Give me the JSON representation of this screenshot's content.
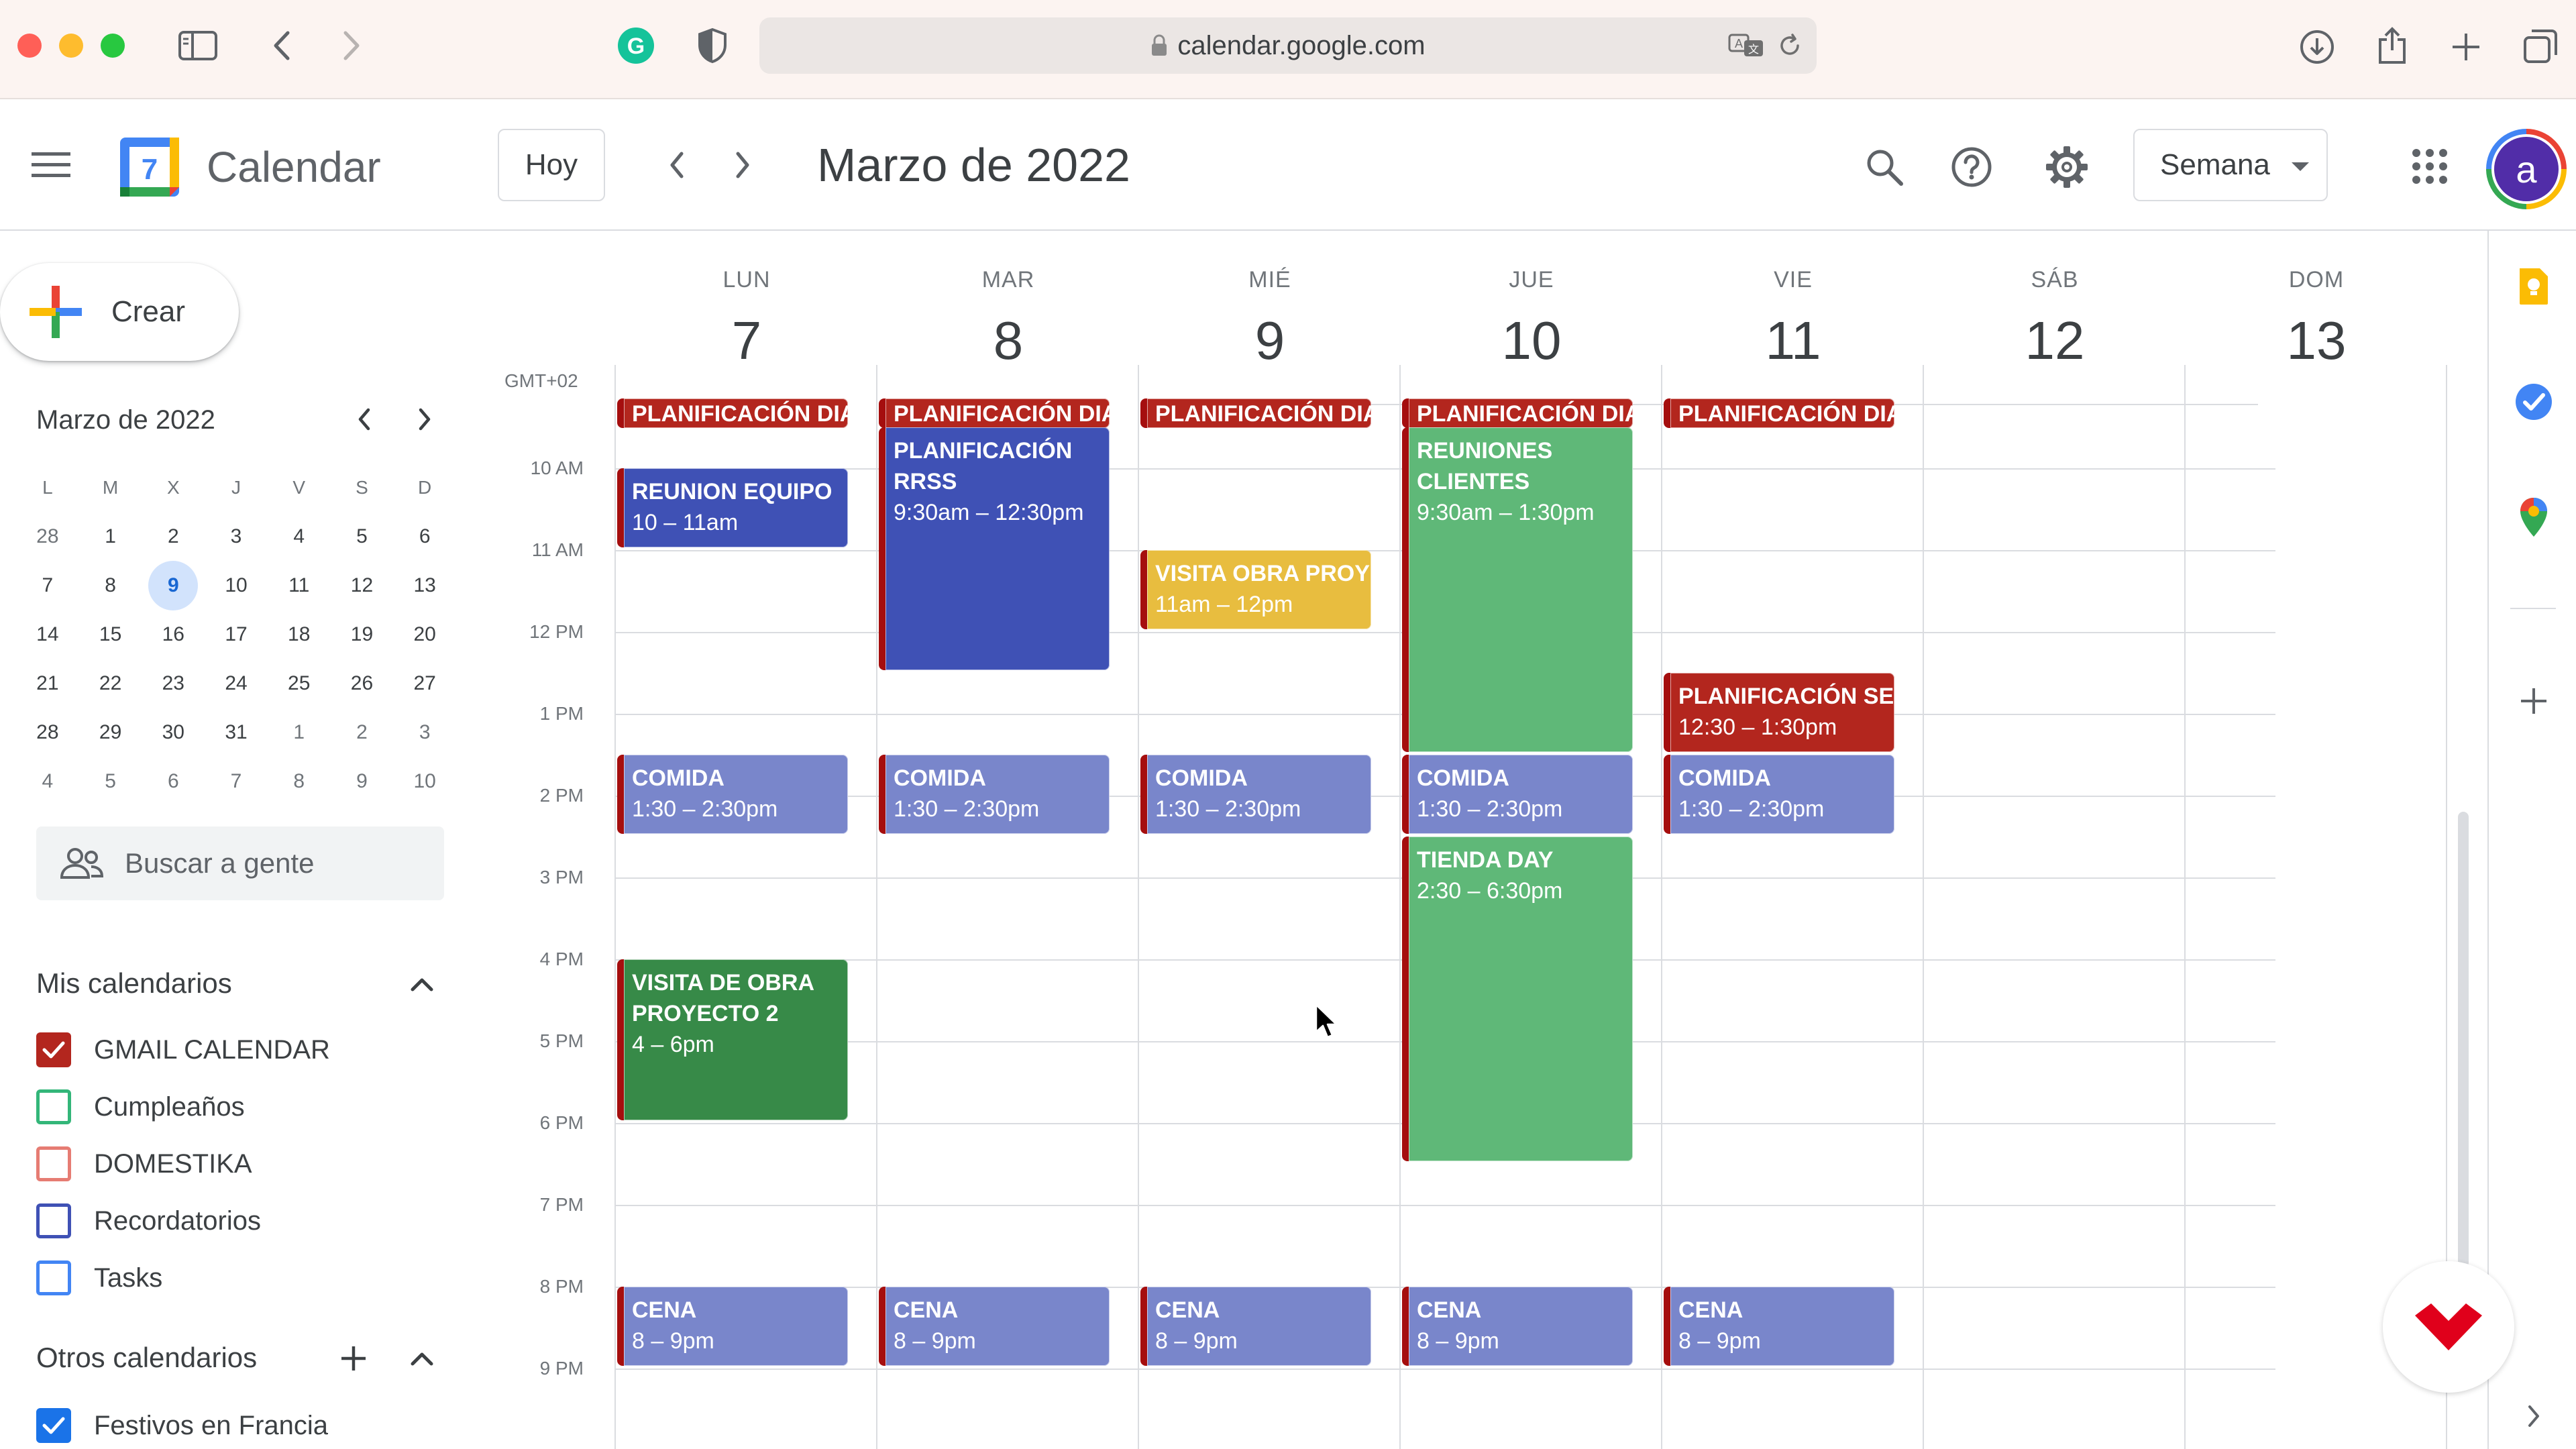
{
  "browser": {
    "url": "calendar.google.com",
    "traffic_lights": [
      "#ff5f57",
      "#febc2e",
      "#28c840"
    ]
  },
  "app": {
    "title": "Calendar",
    "logo_day": "7",
    "today_label": "Hoy",
    "current_title": "Marzo de 2022",
    "view_label": "Semana",
    "avatar_letter": "a"
  },
  "sidebar": {
    "create_label": "Crear",
    "mini_month_title": "Marzo de 2022",
    "weekday_headers": [
      "L",
      "M",
      "X",
      "J",
      "V",
      "S",
      "D"
    ],
    "weeks": [
      [
        "28",
        "1",
        "2",
        "3",
        "4",
        "5",
        "6"
      ],
      [
        "7",
        "8",
        "9",
        "10",
        "11",
        "12",
        "13"
      ],
      [
        "14",
        "15",
        "16",
        "17",
        "18",
        "19",
        "20"
      ],
      [
        "21",
        "22",
        "23",
        "24",
        "25",
        "26",
        "27"
      ],
      [
        "28",
        "29",
        "30",
        "31",
        "1",
        "2",
        "3"
      ],
      [
        "4",
        "5",
        "6",
        "7",
        "8",
        "9",
        "10"
      ]
    ],
    "selected_day": "9",
    "search_people_placeholder": "Buscar a gente",
    "my_calendars_title": "Mis calendarios",
    "my_calendars": [
      {
        "label": "GMAIL CALENDAR",
        "color": "#b3261e",
        "checked": true
      },
      {
        "label": "Cumpleaños",
        "color": "#33b679",
        "checked": false
      },
      {
        "label": "DOMESTIKA",
        "color": "#e67c73",
        "checked": false
      },
      {
        "label": "Recordatorios",
        "color": "#3f51b5",
        "checked": false
      },
      {
        "label": "Tasks",
        "color": "#4285f4",
        "checked": false
      }
    ],
    "other_calendars_title": "Otros calendarios",
    "other_calendars": [
      {
        "label": "Festivos en Francia",
        "color": "#1a73e8",
        "checked": true
      }
    ]
  },
  "week": {
    "timezone": "GMT+02",
    "days": [
      {
        "name": "LUN",
        "date": "7"
      },
      {
        "name": "MAR",
        "date": "8"
      },
      {
        "name": "MIÉ",
        "date": "9"
      },
      {
        "name": "JUE",
        "date": "10"
      },
      {
        "name": "VIE",
        "date": "11"
      },
      {
        "name": "SÁB",
        "date": "12"
      },
      {
        "name": "DOM",
        "date": "13"
      }
    ],
    "hours": [
      "10 AM",
      "11 AM",
      "12 PM",
      "1 PM",
      "2 PM",
      "3 PM",
      "4 PM",
      "5 PM",
      "6 PM",
      "7 PM",
      "8 PM",
      "9 PM"
    ]
  },
  "events": [
    {
      "day": 0,
      "start": 9.0,
      "end": 9.5,
      "title": "PLANIFICACIÓN DIA",
      "time": "",
      "color": "#b3261e"
    },
    {
      "day": 1,
      "start": 9.0,
      "end": 9.5,
      "title": "PLANIFICACIÓN DIA",
      "time": "",
      "color": "#b3261e"
    },
    {
      "day": 2,
      "start": 9.0,
      "end": 9.5,
      "title": "PLANIFICACIÓN DIA",
      "time": "",
      "color": "#b3261e"
    },
    {
      "day": 3,
      "start": 9.0,
      "end": 9.5,
      "title": "PLANIFICACIÓN DIA",
      "time": "",
      "color": "#b3261e"
    },
    {
      "day": 4,
      "start": 9.0,
      "end": 9.5,
      "title": "PLANIFICACIÓN DIA",
      "time": "",
      "color": "#b3261e"
    },
    {
      "day": 0,
      "start": 10.0,
      "end": 11.0,
      "title": "REUNION EQUIPO",
      "time": "10 – 11am",
      "color": "#3f51b5"
    },
    {
      "day": 1,
      "start": 9.5,
      "end": 12.5,
      "title": "PLANIFICACIÓN RRSS",
      "time": "9:30am – 12:30pm",
      "color": "#3f51b5",
      "wrap": true
    },
    {
      "day": 2,
      "start": 11.0,
      "end": 12.0,
      "title": "VISITA OBRA PROYECTO",
      "time": "11am – 12pm",
      "color": "#e8bd3f"
    },
    {
      "day": 3,
      "start": 9.5,
      "end": 13.5,
      "title": "REUNIONES CLIENTES",
      "time": "9:30am – 1:30pm",
      "color": "#5fb878",
      "wrap": true
    },
    {
      "day": 4,
      "start": 12.5,
      "end": 13.5,
      "title": "PLANIFICACIÓN SEMANA",
      "time": "12:30 – 1:30pm",
      "color": "#b3261e"
    },
    {
      "day": 0,
      "start": 13.5,
      "end": 14.5,
      "title": "COMIDA",
      "time": "1:30 – 2:30pm",
      "color": "#7986cb"
    },
    {
      "day": 1,
      "start": 13.5,
      "end": 14.5,
      "title": "COMIDA",
      "time": "1:30 – 2:30pm",
      "color": "#7986cb"
    },
    {
      "day": 2,
      "start": 13.5,
      "end": 14.5,
      "title": "COMIDA",
      "time": "1:30 – 2:30pm",
      "color": "#7986cb"
    },
    {
      "day": 3,
      "start": 13.5,
      "end": 14.5,
      "title": "COMIDA",
      "time": "1:30 – 2:30pm",
      "color": "#7986cb"
    },
    {
      "day": 4,
      "start": 13.5,
      "end": 14.5,
      "title": "COMIDA",
      "time": "1:30 – 2:30pm",
      "color": "#7986cb"
    },
    {
      "day": 3,
      "start": 14.5,
      "end": 18.5,
      "title": "TIENDA DAY",
      "time": "2:30 – 6:30pm",
      "color": "#5fb878"
    },
    {
      "day": 0,
      "start": 16.0,
      "end": 18.0,
      "title": "VISITA DE OBRA PROYECTO 2",
      "time": "4 – 6pm",
      "color": "#378a48",
      "wrap": true
    },
    {
      "day": 0,
      "start": 20.0,
      "end": 21.0,
      "title": "CENA",
      "time": "8 – 9pm",
      "color": "#7986cb"
    },
    {
      "day": 1,
      "start": 20.0,
      "end": 21.0,
      "title": "CENA",
      "time": "8 – 9pm",
      "color": "#7986cb"
    },
    {
      "day": 2,
      "start": 20.0,
      "end": 21.0,
      "title": "CENA",
      "time": "8 – 9pm",
      "color": "#7986cb"
    },
    {
      "day": 3,
      "start": 20.0,
      "end": 21.0,
      "title": "CENA",
      "time": "8 – 9pm",
      "color": "#7986cb"
    },
    {
      "day": 4,
      "start": 20.0,
      "end": 21.0,
      "title": "CENA",
      "time": "8 – 9pm",
      "color": "#7986cb"
    }
  ]
}
